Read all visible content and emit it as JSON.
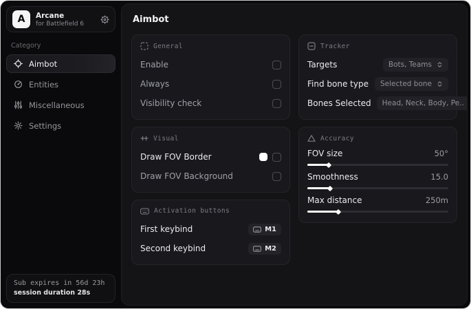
{
  "app": {
    "logo_letter": "A",
    "name": "Arcane",
    "subtitle": "for Battlefield 6"
  },
  "sidebar": {
    "category_label": "Category",
    "items": [
      {
        "label": "Aimbot",
        "icon": "crosshair-icon",
        "active": true
      },
      {
        "label": "Entities",
        "icon": "radar-icon",
        "active": false
      },
      {
        "label": "Miscellaneous",
        "icon": "sliders-vertical-icon",
        "active": false
      },
      {
        "label": "Settings",
        "icon": "gear-icon",
        "active": false
      }
    ],
    "footer": {
      "sub_expires": "Sub expires in 56d 23h",
      "session_duration": "session duration 28s"
    }
  },
  "main": {
    "title": "Aimbot",
    "cards": {
      "general": {
        "header": "General",
        "icon": "dashed-square-icon",
        "rows": [
          {
            "label": "Enable",
            "checked": false
          },
          {
            "label": "Always",
            "checked": false
          },
          {
            "label": "Visibility check",
            "checked": false
          }
        ]
      },
      "visual": {
        "header": "Visual",
        "icon": "adjust-sliders-icon",
        "rows": [
          {
            "label": "Draw FOV Border",
            "color": "#ffffff",
            "checked": false
          },
          {
            "label": "Draw FOV Background",
            "checked": false
          }
        ]
      },
      "activation": {
        "header": "Activation buttons",
        "icon": "keyboard-icon",
        "rows": [
          {
            "label": "First keybind",
            "key": "M1"
          },
          {
            "label": "Second keybind",
            "key": "M2"
          }
        ]
      },
      "tracker": {
        "header": "Tracker",
        "icon": "minus-square-icon",
        "rows": [
          {
            "label": "Targets",
            "value": "Bots, Teams"
          },
          {
            "label": "Find bone type",
            "value": "Selected bone"
          },
          {
            "label": "Bones Selected",
            "value": "Head, Neck, Body, Pe.."
          }
        ]
      },
      "accuracy": {
        "header": "Accuracy",
        "icon": "triangle-icon",
        "rows": [
          {
            "label": "FOV size",
            "value": "50°",
            "fill_percent": 15
          },
          {
            "label": "Smoothness",
            "value": "15.0",
            "fill_percent": 16
          },
          {
            "label": "Max distance",
            "value": "250m",
            "fill_percent": 22
          }
        ]
      }
    }
  }
}
